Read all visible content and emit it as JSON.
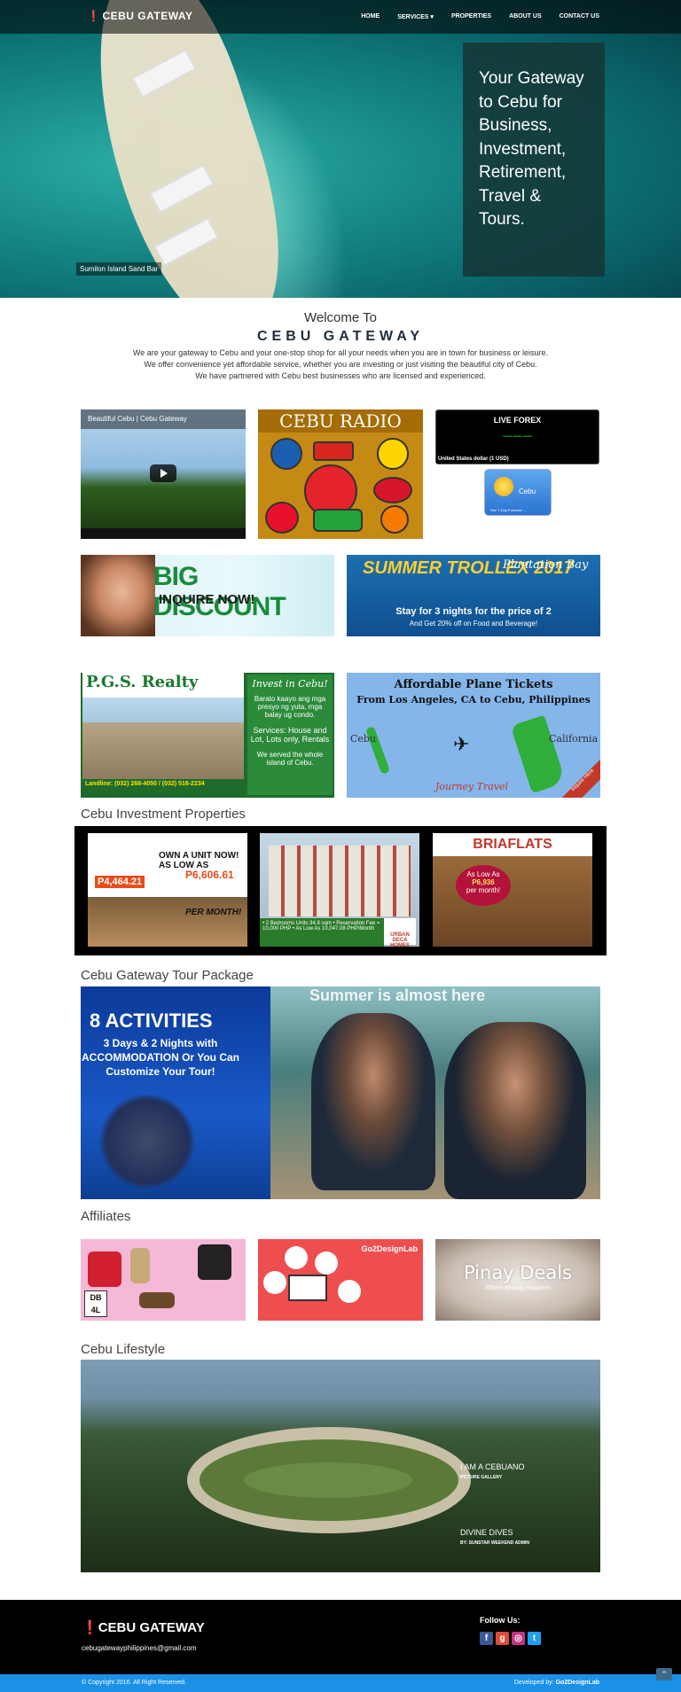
{
  "header": {
    "logo": "CEBU GATEWAY",
    "nav": [
      "HOME",
      "SERVICES ▾",
      "PROPERTIES",
      "ABOUT US",
      "CONTACT US"
    ],
    "hero_text": "Your Gateway to Cebu for Business, Investment, Retirement, Travel & Tours.",
    "hero_caption": "Sumilon Island Sand Bar"
  },
  "welcome": {
    "title": "Welcome To",
    "brand": "CEBU GATEWAY",
    "line1": "We are your gateway to Cebu and your one-stop shop for all your needs when you are in town for business or leisure.",
    "line2": "We offer convenience yet affordable service, whether you are investing or just visiting the beautiful city of Cebu.",
    "line3": "We have partnered with Cebu best businesses who are licensed and experienced."
  },
  "widgets": {
    "video_title": "Beautiful Cebu | Cebu Gateway",
    "radio_title": "CEBU RADIO",
    "forex_title": "LIVE FOREX",
    "forex_currency": "United States dollar (1 USD)",
    "weather_city": "Cebu",
    "weather_forecast": "See 7-Day Forecast →"
  },
  "ads": {
    "big_discount": "BIG DISCOUNT",
    "inquire": "INQUIRE NOW!",
    "summer_title": "SUMMER TROLLEX 2017",
    "plantation": "Plantation Bay",
    "summer_offer": "Stay for 3 nights for the price of 2",
    "summer_sub": "And  Get 20% off on Food and Beverage!",
    "pgs_title": "P.G.S. Realty",
    "pgs_invest": "Invest in Cebu!",
    "pgs_tagalog": "Barato kaayo ang mga presyo ng yuta, mga balay ug condo.",
    "pgs_services": "Services: House and Lot, Lots only, Rentals",
    "pgs_served": "We served the whole island of Cebu.",
    "pgs_contact": "Landline: (032) 268-4050 / (032) 516-2234",
    "plane_title": "Affordable Plane Tickets",
    "plane_sub": "From Los Angeles, CA to Cebu, Philippines",
    "plane_cebu": "Cebu",
    "plane_ca": "California",
    "plane_brand": "Journey Travel",
    "plane_inquire": "Inquire Here"
  },
  "sections": {
    "investment": "Cebu Investment Properties",
    "tour": "Cebu Gateway Tour Package",
    "affiliates": "Affiliates",
    "lifestyle": "Cebu Lifestyle"
  },
  "investment": {
    "own": "OWN A UNIT NOW! AS LOW AS",
    "price1": "P4,464.21",
    "price2": "P6,606.61",
    "per_month": "PER MONTH!",
    "urban_info": "• 2 Bedrooms Units 34.8 sqm • Reservation Fee = 10,000 PHP • As Low As 10,047.08 PHP/Month",
    "urban_logo": "URBAN DECA HOMES",
    "bria_logo": "BRIAFLATS",
    "bria_as_low": "As Low As",
    "bria_price": "P6,936",
    "bria_per": "per month!"
  },
  "tour": {
    "activities": "8 ACTIVITIES",
    "details": "3 Days & 2 Nights with ACCOMMODATION Or You Can Customize Your Tour!",
    "summer": "Summer is almost here"
  },
  "affiliates": {
    "db4l": "DB 4L",
    "go2design": "Go2DesignLab",
    "pinay": "Pinay Deals",
    "pinay_sub": "Where Beauty Happens"
  },
  "lifestyle": {
    "item1": "I AM A CEBUANO",
    "item1_sub": "PICTURE GALLERY",
    "item2": "DIVINE DIVES",
    "item2_sub": "BY: SUNSTAR WEEKEND ADMIN"
  },
  "footer": {
    "logo": "CEBU GATEWAY",
    "email": "cebugatewayphilippines@gmail.com",
    "follow": "Follow Us:",
    "copyright": "© Copyright 2016. All Right Reserved.",
    "developed": "Developed by:",
    "developer": "Go2DesignLab"
  },
  "colors": {
    "nav_bg": "#000000",
    "footer_bg": "#000000",
    "bottom_bar": "#1a91e6",
    "brand_dark": "#1f2d3d"
  }
}
